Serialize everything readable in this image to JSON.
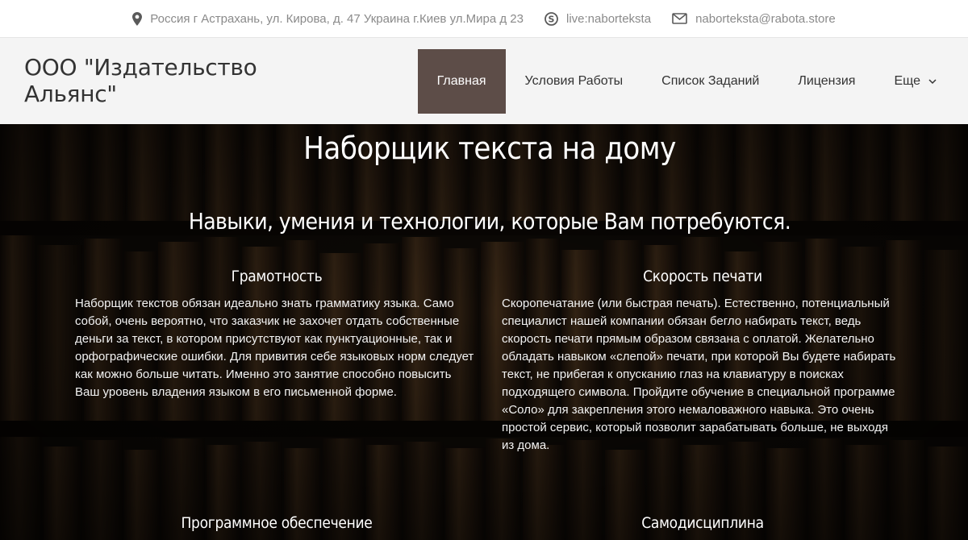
{
  "topbar": {
    "address": "Россия г Астрахань, ул. Кирова, д. 47 Украина г.Киев ул.Мира д 23",
    "skype": "live:naborteksta",
    "email": "naborteksta@rabota.store",
    "icons": [
      "map-pin-icon",
      "skype-icon",
      "envelope-icon"
    ]
  },
  "header": {
    "logo": "ООО \"Издательство Альянс\"",
    "nav": [
      {
        "label": "Главная",
        "active": true
      },
      {
        "label": "Условия Работы"
      },
      {
        "label": "Список Заданий"
      },
      {
        "label": "Лицензия"
      },
      {
        "label": "Еще"
      }
    ]
  },
  "hero": {
    "title": "Наборщик текста на дому",
    "subtitle": "Навыки, умения и технологии, которые Вам потребуются.",
    "sections": [
      {
        "heading": "Грамотность",
        "text": "Наборщик текстов обязан идеально знать грамматику языка. Само собой, очень вероятно, что заказчик не захочет отдать собственные деньги за текст, в котором присутствуют как пунктуационные, так и орфографические ошибки. Для привития себе языковых норм следует как можно больше читать. Именно это занятие способно повысить Ваш уровень владения языком в его письменной форме."
      },
      {
        "heading": "Скорость печати",
        "text": "Скоропечатание (или быстрая печать). Естественно, потенциальный специалист нашей компании обязан бегло набирать текст, ведь скорость печати прямым образом связана с оплатой. Желательно обладать навыком «слепой» печати, при которой Вы будете набирать текст, не прибегая к опусканию глаз на клавиатуру в поисках подходящего символа. Пройдите обучение в специальной программе «Соло» для закрепления этого немаловажного навыка. Это очень простой сервис, который позволит зарабатывать больше, не выходя из дома."
      },
      {
        "heading": "Программное обеспечение"
      },
      {
        "heading": "Самодисциплина"
      }
    ]
  },
  "colors": {
    "nav_active_bg": "#5d4d48",
    "topbar_text": "#8a8a8a",
    "header_bg": "#f4f4f4"
  }
}
